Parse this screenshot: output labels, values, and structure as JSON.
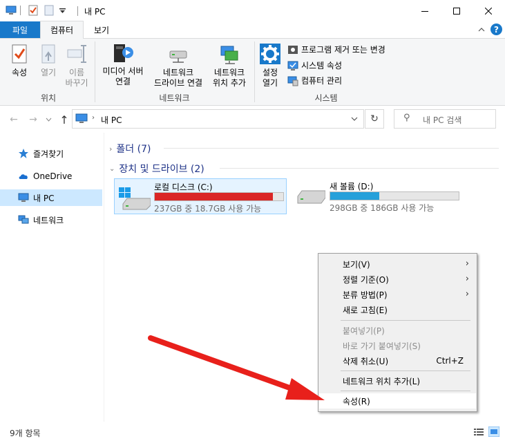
{
  "window": {
    "title": "내 PC",
    "minimize_icon": "minimize-icon",
    "maximize_icon": "maximize-icon",
    "close_icon": "close-icon"
  },
  "quick_access": {
    "separator": "|"
  },
  "tabs": [
    {
      "label": "파일"
    },
    {
      "label": "컴퓨터"
    },
    {
      "label": "보기"
    }
  ],
  "ribbon": {
    "location_group": {
      "label": "위치",
      "properties": "속성",
      "open": "열기",
      "rename": "이름\n바꾸기"
    },
    "network_group": {
      "label": "네트워크",
      "media_server": "미디어 서버\n연결",
      "map_drive": "네트워크\n드라이브 연결",
      "add_location": "네트워크\n위치 추가"
    },
    "system_group": {
      "label": "시스템",
      "settings": "설정\n열기",
      "uninstall": "프로그램 제거 또는 변경",
      "system_properties": "시스템 속성",
      "manage": "컴퓨터 관리"
    }
  },
  "address": {
    "path": "내 PC",
    "search_placeholder": "내 PC 검색"
  },
  "nav_pane": {
    "items": [
      {
        "label": "즐겨찾기"
      },
      {
        "label": "OneDrive"
      },
      {
        "label": "내 PC"
      },
      {
        "label": "네트워크"
      }
    ]
  },
  "content": {
    "folders_header": "폴더 (7)",
    "drives_header": "장치 및 드라이브 (2)",
    "drives": [
      {
        "name": "로컬 디스크 (C:)",
        "info": "237GB 중 18.7GB 사용 가능",
        "used_fraction": 0.92,
        "color": "#da2626"
      },
      {
        "name": "새 볼륨 (D:)",
        "info": "298GB 중 186GB 사용 가능",
        "used_fraction": 0.38,
        "color": "#26a0da"
      }
    ]
  },
  "status": {
    "count": "9개 항목"
  },
  "context_menu": {
    "items": [
      {
        "label": "보기(V)",
        "submenu": true,
        "enabled": true
      },
      {
        "label": "정렬 기준(O)",
        "submenu": true,
        "enabled": true
      },
      {
        "label": "분류 방법(P)",
        "submenu": true,
        "enabled": true
      },
      {
        "label": "새로 고침(E)",
        "enabled": true
      },
      {
        "label": "붙여넣기(P)",
        "enabled": false
      },
      {
        "label": "바로 가기 붙여넣기(S)",
        "enabled": false
      },
      {
        "label": "삭제 취소(U)",
        "shortcut": "Ctrl+Z",
        "enabled": true
      },
      {
        "label": "네트워크 위치 추가(L)",
        "enabled": true
      },
      {
        "label": "속성(R)",
        "enabled": true,
        "highlighted": true
      }
    ],
    "submenu_arrow": "›"
  },
  "annotation": {
    "arrow_color": "#e8201b"
  },
  "colors": {
    "accent": "#1979ca",
    "nav_selected": "#cce8ff"
  }
}
